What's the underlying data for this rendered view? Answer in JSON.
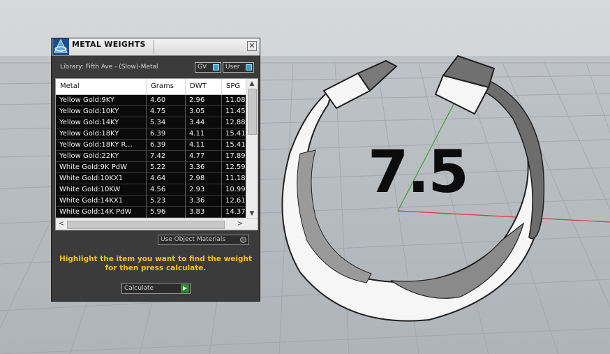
{
  "dialog": {
    "title": "METAL WEIGHTS",
    "close_symbol": "✕",
    "library": "Library: Fifth Ave - (Slow)-Metal",
    "toggles": [
      {
        "label": "GV",
        "on": true
      },
      {
        "label": "User",
        "on": true
      }
    ],
    "table": {
      "columns": [
        "Metal",
        "Grams",
        "DWT",
        "SPG"
      ],
      "rows": [
        [
          "Yellow Gold:9KY",
          "4.60",
          "2.96",
          "11.08"
        ],
        [
          "Yellow Gold:10KY",
          "4.75",
          "3.05",
          "11.45"
        ],
        [
          "Yellow Gold:14KY",
          "5.34",
          "3.44",
          "12.88"
        ],
        [
          "Yellow Gold:18KY",
          "6.39",
          "4.11",
          "15.41"
        ],
        [
          "Yellow Gold:18KY R...",
          "6.39",
          "4.11",
          "15.41"
        ],
        [
          "Yellow Gold:22KY",
          "7.42",
          "4.77",
          "17.89"
        ],
        [
          "White Gold:9K PdW",
          "5.22",
          "3.36",
          "12.59"
        ],
        [
          "White Gold:10KX1",
          "4.64",
          "2.98",
          "11.18"
        ],
        [
          "White Gold:10KW",
          "4.56",
          "2.93",
          "10.99"
        ],
        [
          "White Gold:14KX1",
          "5.23",
          "3.36",
          "12.61"
        ],
        [
          "White Gold:14K PdW",
          "5.96",
          "3.83",
          "14.37"
        ]
      ],
      "scroll_up": "▲",
      "scroll_down": "▼",
      "scroll_left": "<",
      "scroll_right": ">"
    },
    "use_object_materials": "Use Object Materials",
    "instructions_line1": "Highlight the item you want to find the weight",
    "instructions_line2": "for then press calculate.",
    "calculate_label": "Calculate",
    "calculate_arrow": "▶"
  },
  "viewport": {
    "ring_size": "7.5"
  },
  "colors": {
    "accent_yellow": "#f2c21b",
    "toggle_blue": "#3aa0c8",
    "go_green": "#2d8a2d"
  }
}
